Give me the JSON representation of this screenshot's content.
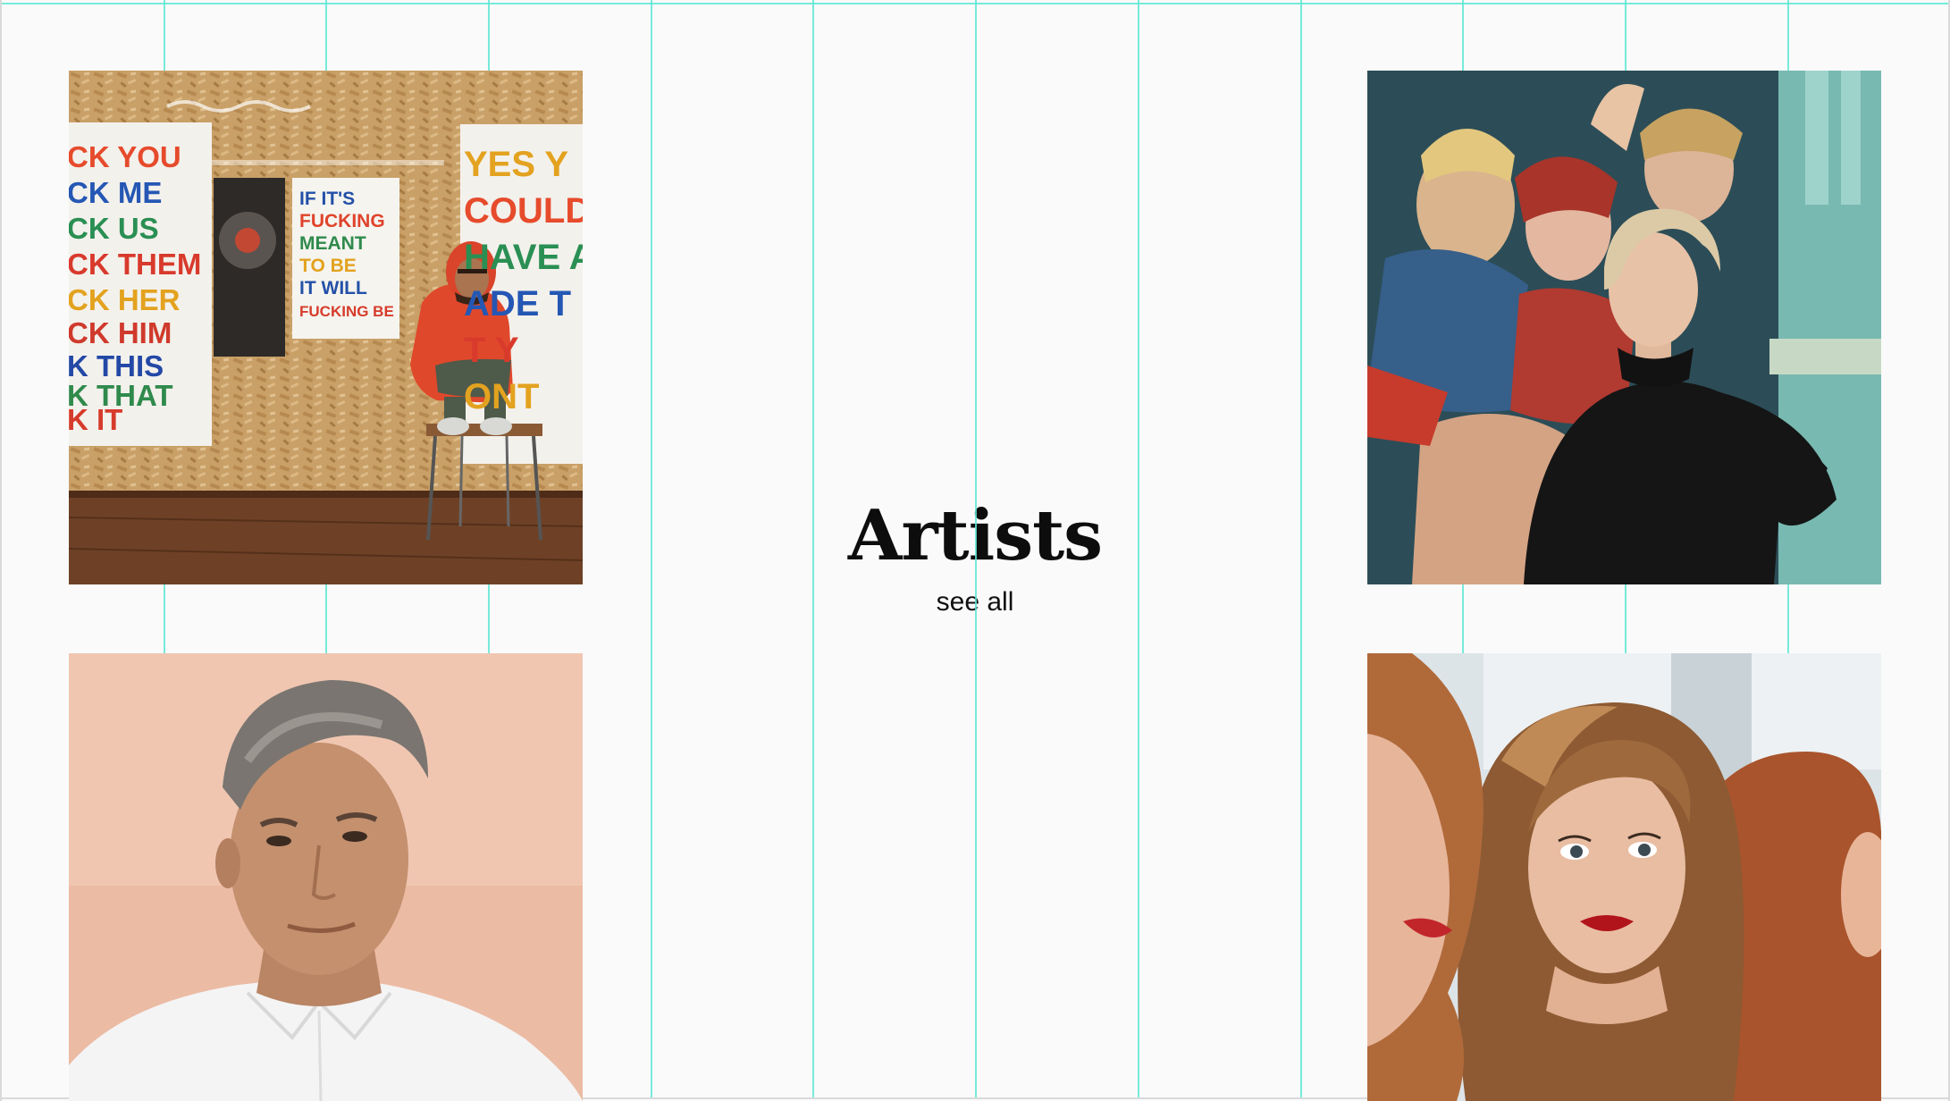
{
  "section": {
    "title": "Artists",
    "see_all_label": "see all"
  },
  "artists": [
    {
      "photo_icon": "artist-photo-graffiti-wall",
      "sign_left_lines": [
        "CK YOU",
        "CK ME",
        "CK US",
        "CK THEM",
        "CK HER",
        "CK HIM",
        "K THIS",
        "K THAT",
        "K IT"
      ],
      "sign_middle_lines": [
        "IF IT'S",
        "FUCKING",
        "MEANT",
        "TO BE",
        "IT WILL",
        "FUCKING BE"
      ],
      "sign_right_lines": [
        "YES Y",
        "COULD",
        "HAVE A",
        "ADE T",
        "T Y",
        "ONT"
      ]
    },
    {
      "photo_icon": "artist-photo-painting-studio"
    },
    {
      "photo_icon": "artist-photo-portrait-pink"
    },
    {
      "photo_icon": "artist-photo-group-portrait"
    }
  ],
  "colors": {
    "background": "#fafafa",
    "guide": "#5ee6d3",
    "text": "#0d0d0d"
  }
}
